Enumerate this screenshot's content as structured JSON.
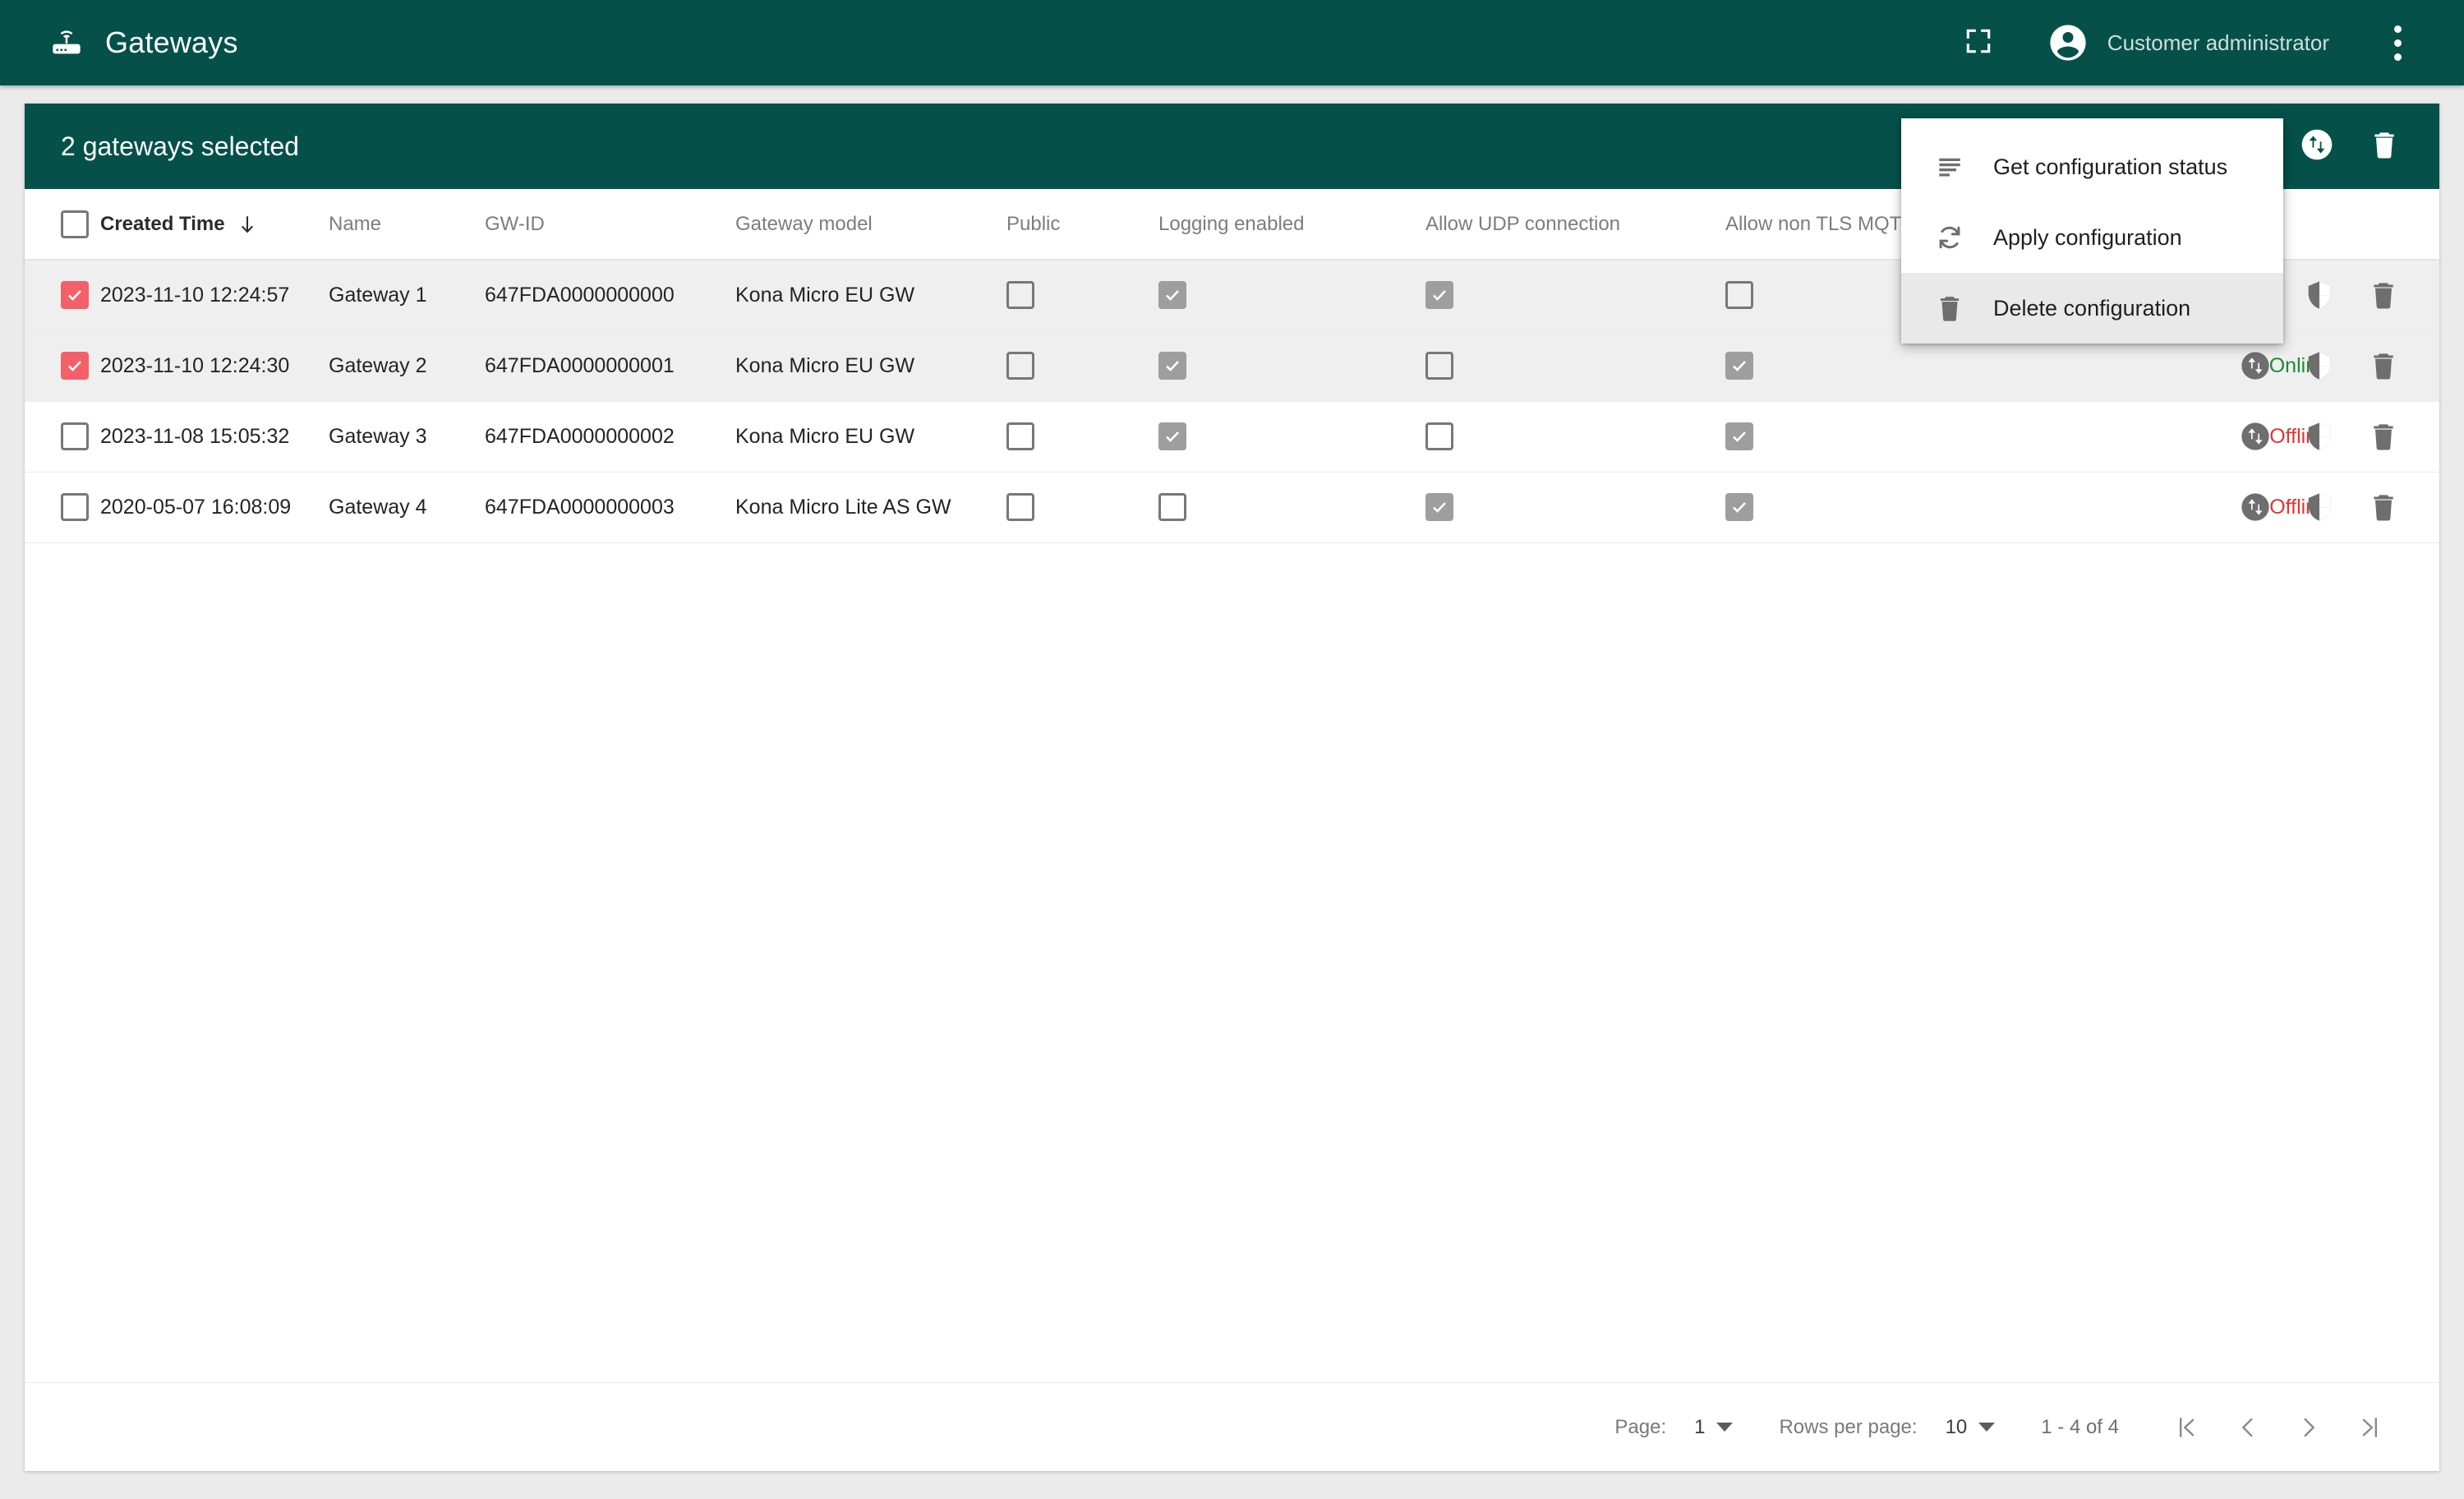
{
  "appbar": {
    "title": "Gateways",
    "app_icon": "router-icon",
    "fullscreen_icon": "fullscreen-icon",
    "avatar_icon": "account-circle-icon",
    "user_name": "Customer administrator",
    "overflow_icon": "more-vert-icon"
  },
  "toolbar": {
    "selection_text": "2 gateways selected",
    "actions": [
      {
        "icon": "list-icon",
        "name": "toolbar-get-status-button"
      },
      {
        "icon": "swap-vert-circle-icon",
        "name": "toolbar-swap-button"
      },
      {
        "icon": "trash-icon",
        "name": "toolbar-delete-button"
      }
    ]
  },
  "menu": {
    "items": [
      {
        "label": "Get configuration status",
        "icon": "short-text-icon",
        "hovered": false
      },
      {
        "label": "Apply configuration",
        "icon": "sync-icon",
        "hovered": false
      },
      {
        "label": "Delete configuration",
        "icon": "trash-icon",
        "hovered": true
      }
    ]
  },
  "table": {
    "headers": [
      {
        "label": "Created Time",
        "sorted": true,
        "sort_dir": "desc"
      },
      {
        "label": "Name",
        "sorted": false
      },
      {
        "label": "GW-ID",
        "sorted": false
      },
      {
        "label": "Gateway model",
        "sorted": false
      },
      {
        "label": "Public",
        "sorted": false
      },
      {
        "label": "Logging enabled",
        "sorted": false
      },
      {
        "label": "Allow UDP connection",
        "sorted": false
      },
      {
        "label": "Allow non TLS MQTT co",
        "sorted": false
      }
    ],
    "select_all_checked": false,
    "rows": [
      {
        "selected": true,
        "created_time": "2023-11-10 12:24:57",
        "name": "Gateway 1",
        "gw_id": "647FDA0000000000",
        "model": "Kona Micro EU GW",
        "public": false,
        "logging_enabled": true,
        "allow_udp": true,
        "allow_non_tls_mqtt": false,
        "status": ""
      },
      {
        "selected": true,
        "created_time": "2023-11-10 12:24:30",
        "name": "Gateway 2",
        "gw_id": "647FDA0000000001",
        "model": "Kona Micro EU GW",
        "public": false,
        "logging_enabled": true,
        "allow_udp": false,
        "allow_non_tls_mqtt": true,
        "status": "Online"
      },
      {
        "selected": false,
        "created_time": "2023-11-08 15:05:32",
        "name": "Gateway 3",
        "gw_id": "647FDA0000000002",
        "model": "Kona Micro EU GW",
        "public": false,
        "logging_enabled": true,
        "allow_udp": false,
        "allow_non_tls_mqtt": true,
        "status": "Offline"
      },
      {
        "selected": false,
        "created_time": "2020-05-07 16:08:09",
        "name": "Gateway 4",
        "gw_id": "647FDA0000000003",
        "model": "Kona Micro Lite AS GW",
        "public": false,
        "logging_enabled": false,
        "allow_udp": true,
        "allow_non_tls_mqtt": true,
        "status": "Offline"
      }
    ],
    "row_action_icons": [
      "swap-vert-circle-icon",
      "security-shield-icon",
      "trash-icon"
    ]
  },
  "paginator": {
    "page_label": "Page:",
    "page_value": "1",
    "rows_per_page_label": "Rows per page:",
    "rows_per_page_value": "10",
    "range_label": "1 - 4 of 4",
    "first_icon": "first-page-icon",
    "prev_icon": "prev-page-icon",
    "next_icon": "next-page-icon",
    "last_icon": "last-page-icon"
  },
  "colors": {
    "brand": "#05514a",
    "accent_checkbox": "#f4606a",
    "status_online": "#1d8a32",
    "status_offline": "#e03535",
    "row_selected_bg": "#efefef"
  }
}
